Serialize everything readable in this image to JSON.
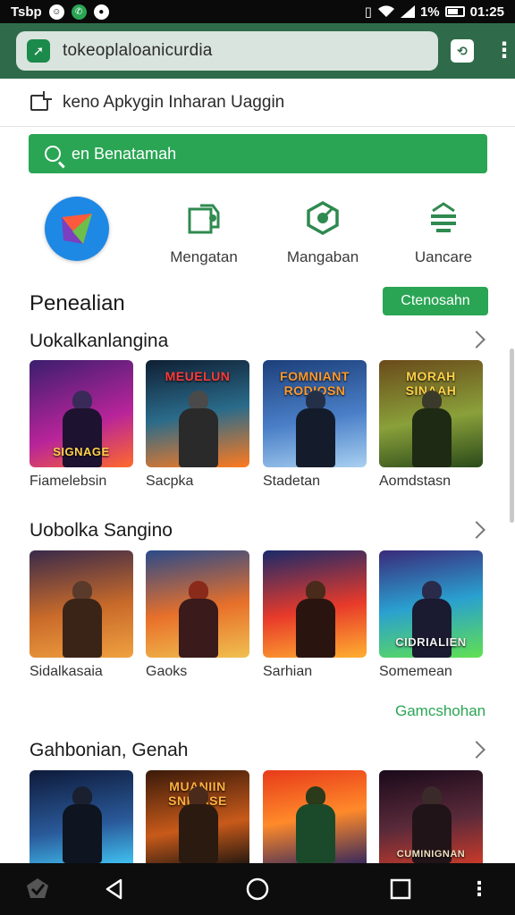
{
  "status_bar": {
    "carrier": "Tsbp",
    "battery_percent": "1%",
    "time": "01:25"
  },
  "url_bar": {
    "url": "tokeoplaloanicurdia"
  },
  "info_line": {
    "text": "keno Apkygin Inharan Uaggin"
  },
  "search": {
    "placeholder": "en Benatamah"
  },
  "categories": [
    {
      "label": "",
      "icon": "app-logo-icon"
    },
    {
      "label": "Mengatan",
      "icon": "share-icon"
    },
    {
      "label": "Mangaban",
      "icon": "settings-hex-icon"
    },
    {
      "label": "Uancare",
      "icon": "equalizer-icon"
    }
  ],
  "section": {
    "title": "Penealian",
    "button": "Ctenosahn"
  },
  "rows": [
    {
      "title": "Uokalkanlangina",
      "items": [
        {
          "label": "Fiamelebsin",
          "caption": "SIGNAGE"
        },
        {
          "label": "Sacpka",
          "caption": "MEUELUN"
        },
        {
          "label": "Stadetan",
          "caption": "FOMNIANT RODIOSN"
        },
        {
          "label": "Aomdstasn",
          "caption": "MORAH SINAAH"
        }
      ]
    },
    {
      "title": "Uobolka Sangino",
      "items": [
        {
          "label": "Sidalkasaia",
          "caption": ""
        },
        {
          "label": "Gaoks",
          "caption": ""
        },
        {
          "label": "Sarhian",
          "caption": ""
        },
        {
          "label": "Somemean",
          "caption": "CIDRIALIEN"
        }
      ]
    },
    {
      "title": "Gahbonian, Genah",
      "items": [
        {
          "label": "",
          "caption": ""
        },
        {
          "label": "",
          "caption": "MUANIIN SNIAASE"
        },
        {
          "label": "",
          "caption": ""
        },
        {
          "label": "",
          "caption": "CUMINIGNAN"
        }
      ]
    }
  ],
  "more_link": "Gamcshohan",
  "colors": {
    "accent": "#2aa554",
    "toolbar": "#2f6b4a"
  }
}
